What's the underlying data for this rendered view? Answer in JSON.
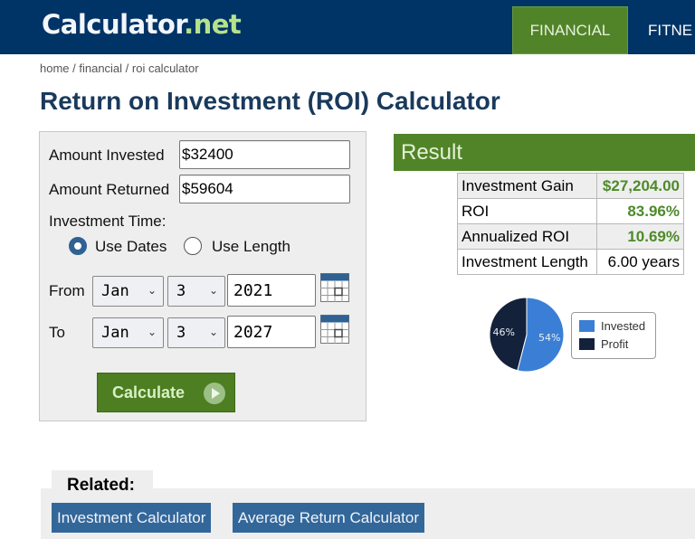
{
  "header": {
    "logo_main": "Calculator",
    "logo_suffix": ".net",
    "nav": [
      {
        "label": "FINANCIAL",
        "active": true
      },
      {
        "label": "FITNE",
        "active": false
      }
    ]
  },
  "breadcrumb": "home / financial / roi calculator",
  "page_title": "Return on Investment (ROI) Calculator",
  "form": {
    "amount_invested_label": "Amount Invested",
    "amount_invested_value": "$32400",
    "amount_returned_label": "Amount Returned",
    "amount_returned_value": "$59604",
    "investment_time_label": "Investment Time:",
    "radio_use_dates": "Use Dates",
    "radio_use_length": "Use Length",
    "selected_radio": "Use Dates",
    "from_label": "From",
    "from_month": "Jan",
    "from_day": "3",
    "from_year": "2021",
    "to_label": "To",
    "to_month": "Jan",
    "to_day": "3",
    "to_year": "2027",
    "calculate_label": "Calculate"
  },
  "result": {
    "title": "Result",
    "rows": [
      {
        "label": "Investment Gain",
        "value": "$27,204.00"
      },
      {
        "label": "ROI",
        "value": "83.96%"
      },
      {
        "label": "Annualized ROI",
        "value": "10.69%"
      },
      {
        "label": "Investment Length",
        "value": "6.00 years"
      }
    ],
    "pie": {
      "slices": [
        {
          "name": "Invested",
          "percent": 54,
          "label": "54%",
          "color": "#3a7fd5"
        },
        {
          "name": "Profit",
          "percent": 46,
          "label": "46%",
          "color": "#13223a"
        }
      ]
    }
  },
  "related": {
    "title": "Related:",
    "links": [
      "Investment Calculator",
      "Average Return Calculator"
    ]
  },
  "colors": {
    "header_bg": "#003366",
    "accent_green": "#518428",
    "link_blue": "#33679a"
  }
}
